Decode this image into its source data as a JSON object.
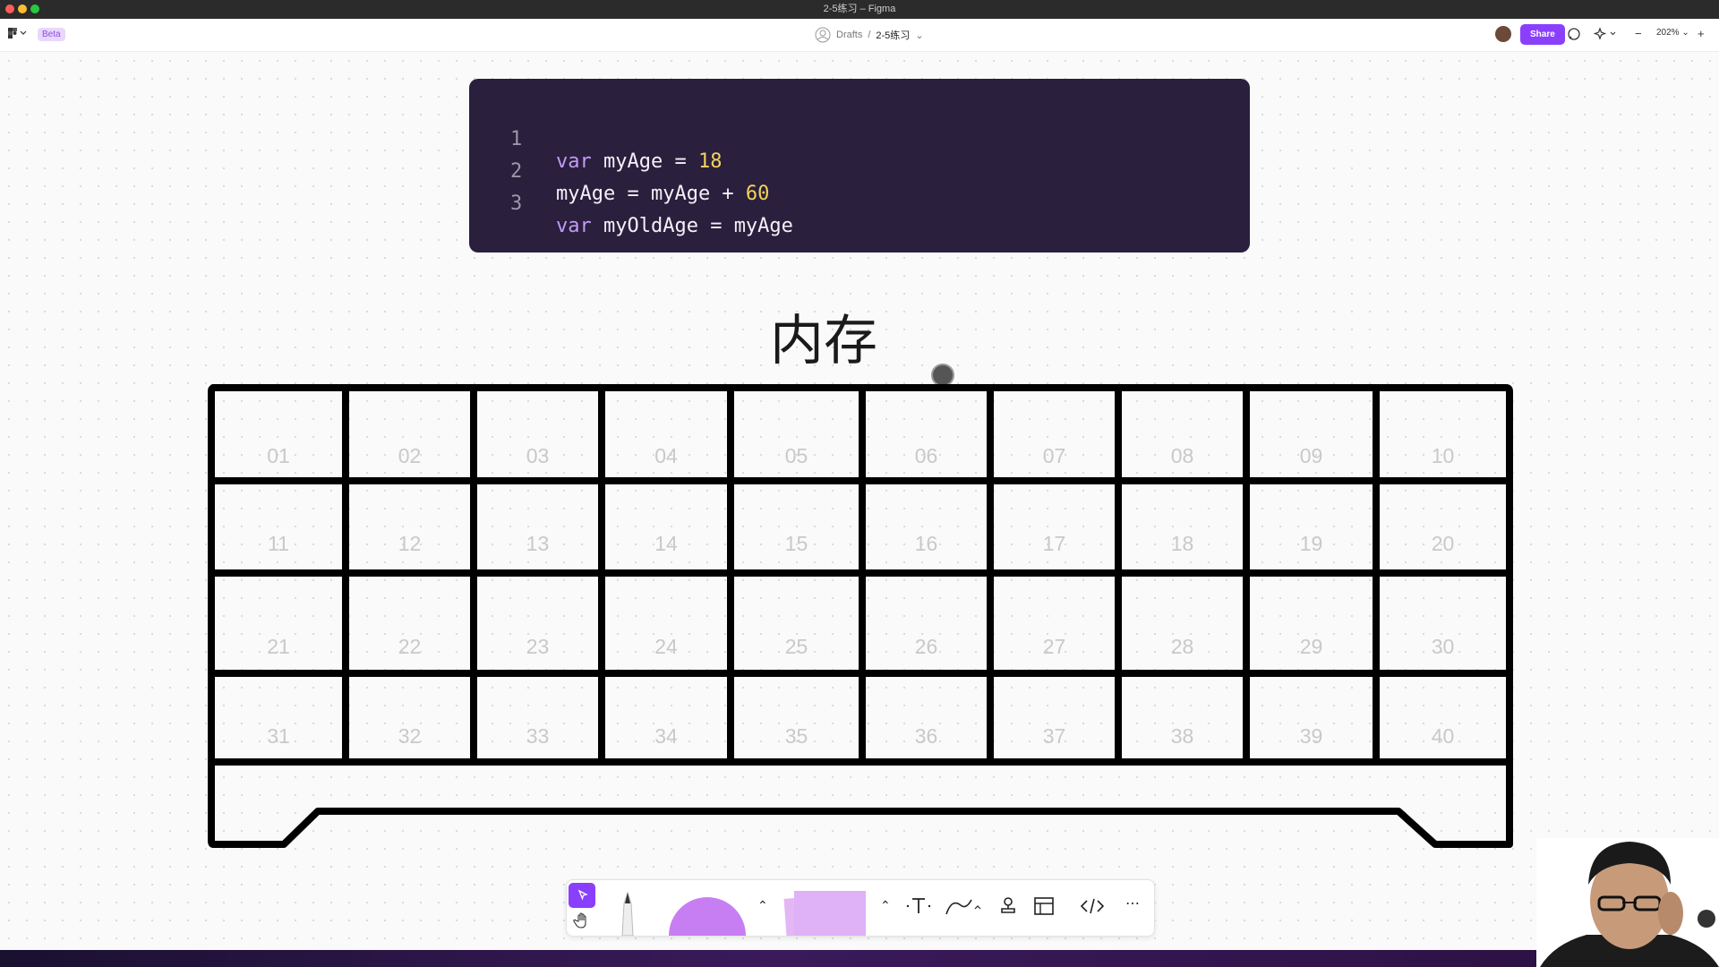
{
  "window": {
    "title": "2-5练习 – Figma"
  },
  "topbar": {
    "beta_label": "Beta",
    "breadcrumb_root": "Drafts",
    "breadcrumb_sep": "/",
    "breadcrumb_file": "2-5练习",
    "share_label": "Share",
    "zoom_label": "202%"
  },
  "code": {
    "lines": [
      {
        "num": "1",
        "kw": "var",
        "rest": " myAge = ",
        "num_val": "18",
        "tail": ""
      },
      {
        "num": "2",
        "kw": "",
        "rest": "myAge = myAge + ",
        "num_val": "60",
        "tail": ""
      },
      {
        "num": "3",
        "kw": "var",
        "rest": " myOldAge = myAge",
        "num_val": "",
        "tail": ""
      }
    ]
  },
  "memory": {
    "title": "内存",
    "cells": [
      "01",
      "02",
      "03",
      "04",
      "05",
      "06",
      "07",
      "08",
      "09",
      "10",
      "11",
      "12",
      "13",
      "14",
      "15",
      "16",
      "17",
      "18",
      "19",
      "20",
      "21",
      "22",
      "23",
      "24",
      "25",
      "26",
      "27",
      "28",
      "29",
      "30",
      "31",
      "32",
      "33",
      "34",
      "35",
      "36",
      "37",
      "38",
      "39",
      "40"
    ]
  },
  "icons": {
    "menu": "figma-menu-icon",
    "comment": "comment-icon",
    "move": "move-tool-icon",
    "hand": "hand-tool-icon",
    "pen": "pen-tool-icon",
    "text": "text-tool-icon",
    "connector": "connector-tool-icon",
    "stamp": "stamp-tool-icon",
    "table": "table-tool-icon",
    "code": "code-block-icon",
    "more": "more-icon"
  },
  "colors": {
    "accent": "#8a3ffc",
    "code_bg": "#2a1f3d",
    "keyword": "#c39bf5",
    "number": "#f3d35a"
  }
}
